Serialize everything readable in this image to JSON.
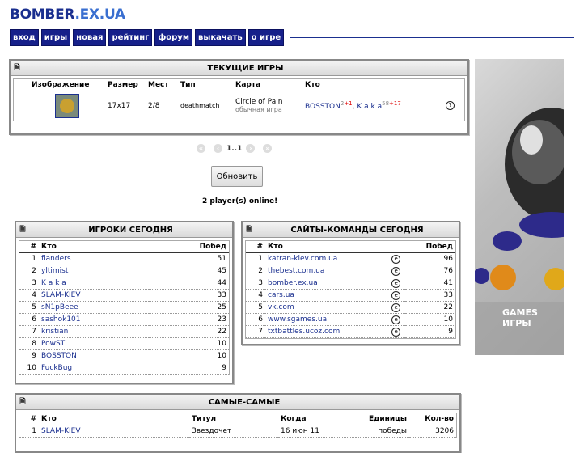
{
  "logo": {
    "part1": "BOMBER",
    "part2": ".EX.UA"
  },
  "nav": [
    "вход",
    "игры",
    "новая",
    "рейтинг",
    "форум",
    "выкачать",
    "о игре"
  ],
  "current_games": {
    "title": "ТЕКУЩИЕ ИГРЫ",
    "headers": [
      "Изображение",
      "Размер",
      "Мест",
      "Тип",
      "Карта",
      "Кто"
    ],
    "row": {
      "size": "17x17",
      "places": "2/8",
      "type": "deathmatch",
      "map": "Circle of Pain",
      "map_sub": "обычная игра",
      "player1": "BOSSTON",
      "player1_sup_a": "2",
      "player1_sup_b": "+1",
      "sep": ",",
      "player2": "K a k a",
      "player2_sup_a": "58",
      "player2_sup_b": "+17",
      "help": "?"
    }
  },
  "pager": {
    "label": "1..1"
  },
  "refresh_label": "Обновить",
  "online_text": "2 player(s) online!",
  "players_today": {
    "title": "ИГРОКИ СЕГОДНЯ",
    "headers": [
      "#",
      "Кто",
      "Побед"
    ],
    "rows": [
      [
        "1",
        "flanders",
        "51"
      ],
      [
        "2",
        "yltimist",
        "45"
      ],
      [
        "3",
        "K a k a",
        "44"
      ],
      [
        "4",
        "SLAM-KIEV",
        "33"
      ],
      [
        "5",
        "sN1pBeee",
        "25"
      ],
      [
        "6",
        "sashok101",
        "23"
      ],
      [
        "7",
        "kristian",
        "22"
      ],
      [
        "8",
        "PowST",
        "10"
      ],
      [
        "9",
        "BOSSTON",
        "10"
      ],
      [
        "10",
        "FuckBug",
        "9"
      ]
    ]
  },
  "sites_today": {
    "title": "САЙТЫ-КОМАНДЫ СЕГОДНЯ",
    "headers": [
      "#",
      "Кто",
      "Побед"
    ],
    "rows": [
      [
        "1",
        "katran-kiev.com.ua",
        "96"
      ],
      [
        "2",
        "thebest.com.ua",
        "76"
      ],
      [
        "3",
        "bomber.ex.ua",
        "41"
      ],
      [
        "4",
        "cars.ua",
        "33"
      ],
      [
        "5",
        "vk.com",
        "22"
      ],
      [
        "6",
        "www.sgames.ua",
        "10"
      ],
      [
        "7",
        "txtbattles.ucoz.com",
        "9"
      ]
    ]
  },
  "best": {
    "title": "САМЫЕ-САМЫЕ",
    "headers": [
      "#",
      "Кто",
      "Титул",
      "Когда",
      "Единицы",
      "Кол-во"
    ],
    "rows": [
      [
        "1",
        "SLAM-KIEV",
        "Звездочет",
        "16 июн 11",
        "победы",
        "3206"
      ]
    ]
  },
  "ad": {
    "line1": "GAMES",
    "line2": "ИГРЫ"
  }
}
